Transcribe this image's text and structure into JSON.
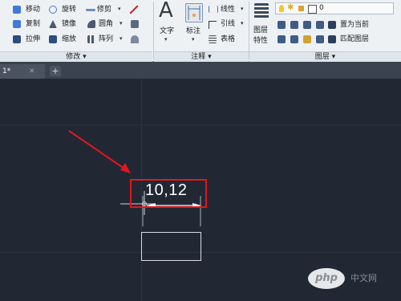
{
  "ribbon": {
    "modify": {
      "move": "移动",
      "rotate": "旋转",
      "trim": "修剪",
      "copy": "复制",
      "mirror": "镜像",
      "fillet": "圆角",
      "stretch": "拉伸",
      "scale": "缩放",
      "array": "阵列",
      "title": "修改 ▾"
    },
    "annotation": {
      "text": "文字",
      "dimension": "标注",
      "linear": "线性",
      "leader": "引线",
      "table": "表格",
      "big_a": "A",
      "title": "注释 ▾"
    },
    "layers": {
      "properties_line1": "图层",
      "properties_line2": "特性",
      "current_layer": "0",
      "make_current": "置为当前",
      "match_layer": "匹配图层",
      "title": "图层 ▾"
    }
  },
  "tabs": {
    "drawing_tab": "1*",
    "close_glyph": "✕",
    "add_glyph": "+"
  },
  "canvas": {
    "dimension_text": "10,12"
  },
  "watermark": {
    "logo_text": "php",
    "cn_text": "中文网"
  },
  "colors": {
    "canvas_bg": "#212834",
    "ribbon_bg": "#eef1f4",
    "highlight": "#e2171b",
    "arrow": "#e2171b"
  },
  "icons": [
    "move-icon",
    "rotate-icon",
    "trim-icon",
    "copy-icon",
    "mirror-icon",
    "fillet-icon",
    "stretch-icon",
    "scale-icon",
    "array-icon",
    "text-icon",
    "dimension-icon",
    "layer-icon",
    "lightbulb-icon",
    "sun-icon",
    "lock-icon"
  ]
}
